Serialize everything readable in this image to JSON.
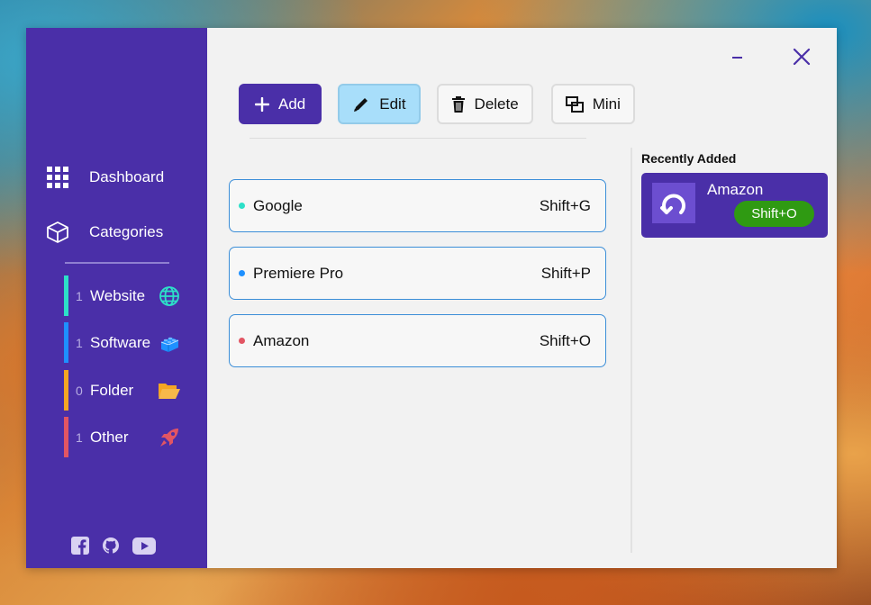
{
  "sidebar": {
    "nav": [
      {
        "label": "Dashboard",
        "icon": "grid-icon"
      },
      {
        "label": "Categories",
        "icon": "cube-icon"
      }
    ],
    "categories": [
      {
        "count": "1",
        "label": "Website",
        "color": "#2de0c8",
        "icon": "globe-icon"
      },
      {
        "count": "1",
        "label": "Software",
        "color": "#1e90ff",
        "icon": "lego-block-icon"
      },
      {
        "count": "0",
        "label": "Folder",
        "color": "#f5a623",
        "icon": "folder-open-icon"
      },
      {
        "count": "1",
        "label": "Other",
        "color": "#e25563",
        "icon": "rocket-icon"
      }
    ],
    "social": [
      "facebook-icon",
      "github-icon",
      "youtube-icon"
    ]
  },
  "toolbar": {
    "add_label": "Add",
    "edit_label": "Edit",
    "delete_label": "Delete",
    "mini_label": "Mini"
  },
  "shortcuts": [
    {
      "name": "Google",
      "key": "Shift+G",
      "dot_color": "#2de0c8"
    },
    {
      "name": "Premiere Pro",
      "key": "Shift+P",
      "dot_color": "#1e90ff"
    },
    {
      "name": "Amazon",
      "key": "Shift+O",
      "dot_color": "#e25563"
    }
  ],
  "recent": {
    "title": "Recently Added",
    "name": "Amazon",
    "key": "Shift+O"
  },
  "colors": {
    "accent": "#4a2fa8",
    "edit_active": "#a8defa",
    "key_badge": "#2f9a12"
  }
}
